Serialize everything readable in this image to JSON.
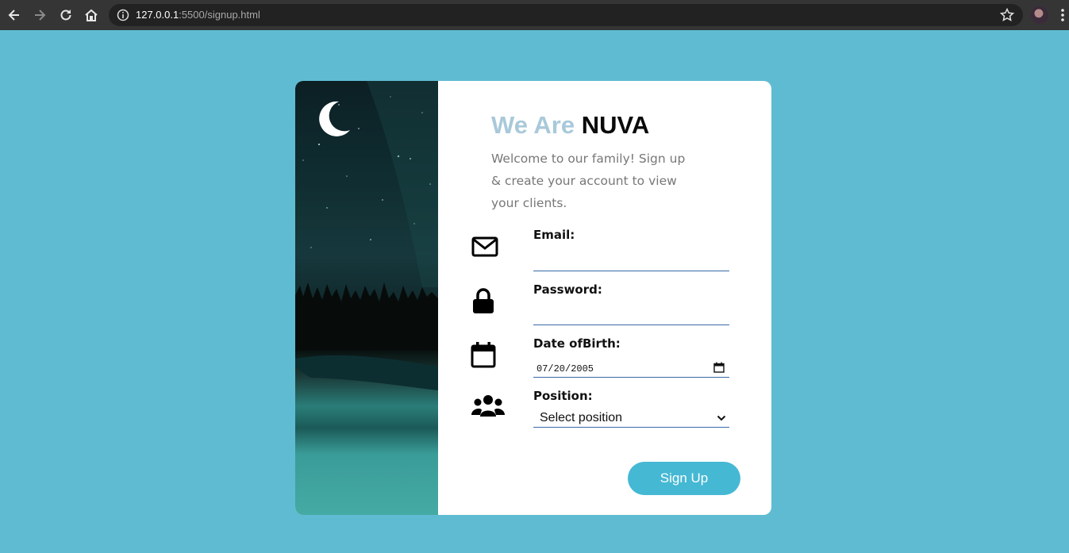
{
  "browser": {
    "url_host": "127.0.0.1",
    "url_path": ":5500/signup.html",
    "icons": [
      "back-icon",
      "forward-icon",
      "reload-icon",
      "home-icon",
      "info-icon",
      "star-icon",
      "avatar",
      "kebab-menu-icon"
    ]
  },
  "hero": {
    "icon": "moon-icon"
  },
  "header": {
    "title_light": "We Are",
    "title_dark": "NUVA",
    "subtitle": "Welcome to our family! Sign up & create your account to view your clients."
  },
  "form": {
    "email": {
      "label": "Email:",
      "value": "",
      "icon": "envelope-icon"
    },
    "password": {
      "label": "Password:",
      "value": "",
      "icon": "lock-icon"
    },
    "dob": {
      "label": "Date ofBirth:",
      "value": "07/20/2005",
      "icon": "calendar-icon"
    },
    "position": {
      "label": "Position:",
      "selected": "Select position",
      "icon": "users-icon"
    },
    "submit_label": "Sign Up"
  },
  "colors": {
    "page_bg": "#5fbbd2",
    "title_light": "#a9c9da",
    "button": "#45b8d4",
    "input_underline": "#3b6aa8"
  }
}
